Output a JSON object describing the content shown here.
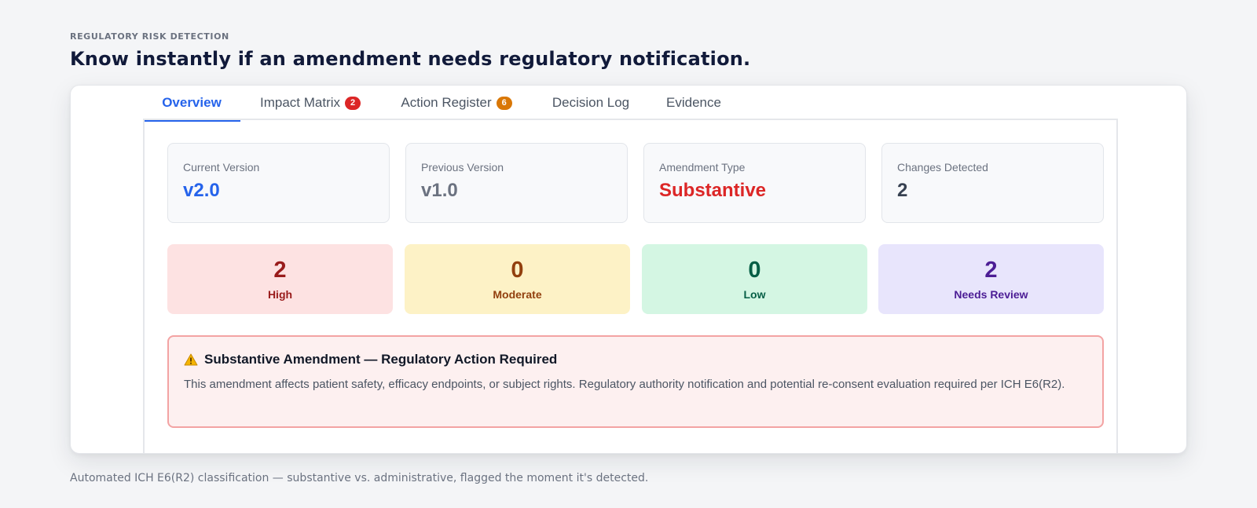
{
  "section": {
    "eyebrow": "REGULATORY RISK DETECTION",
    "headline": "Know instantly if an amendment needs regulatory notification.",
    "caption": "Automated ICH E6(R2) classification — substantive vs. administrative, flagged the moment it's detected."
  },
  "tabs": [
    {
      "label": "Overview",
      "active": true
    },
    {
      "label": "Impact Matrix",
      "badge": "2",
      "badge_color": "#dc2626"
    },
    {
      "label": "Action Register",
      "badge": "6",
      "badge_color": "#d97706"
    },
    {
      "label": "Decision Log"
    },
    {
      "label": "Evidence"
    }
  ],
  "stats": [
    {
      "label": "Current Version",
      "value": "v2.0",
      "color": "#2563eb"
    },
    {
      "label": "Previous Version",
      "value": "v1.0",
      "color": "#6b7280"
    },
    {
      "label": "Amendment Type",
      "value": "Substantive",
      "color": "#dc2626"
    },
    {
      "label": "Changes Detected",
      "value": "2",
      "color": "#374151"
    }
  ],
  "severity": [
    {
      "count": "2",
      "label": "High",
      "bg": "#fde2e2",
      "color": "#991b1b"
    },
    {
      "count": "0",
      "label": "Moderate",
      "bg": "#fdf2c6",
      "color": "#92400e"
    },
    {
      "count": "0",
      "label": "Low",
      "bg": "#d4f6e3",
      "color": "#065f46"
    },
    {
      "count": "2",
      "label": "Needs Review",
      "bg": "#e8e5fc",
      "color": "#4c1d95"
    }
  ],
  "alert": {
    "icon": "warning-icon",
    "title": "Substantive Amendment — Regulatory Action Required",
    "body": "This amendment affects patient safety, efficacy endpoints, or subject rights. Regulatory authority notification and potential re-consent evaluation required per ICH E6(R2)."
  }
}
